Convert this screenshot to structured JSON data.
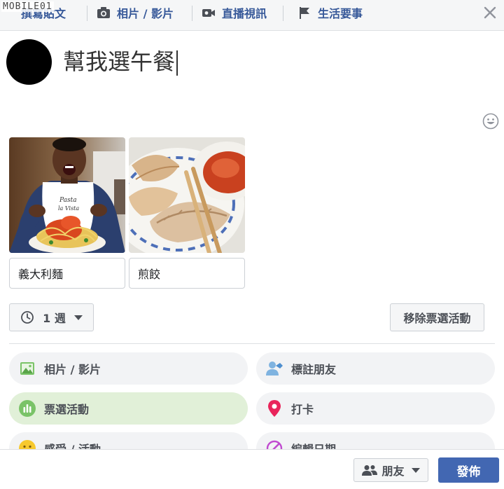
{
  "watermark": "MOBILE01",
  "tabs": [
    {
      "label": "撰寫貼文",
      "icon": "pencil-icon"
    },
    {
      "label": "相片 / 影片",
      "icon": "camera-icon"
    },
    {
      "label": "直播視訊",
      "icon": "video-camera-icon"
    },
    {
      "label": "生活要事",
      "icon": "flag-icon"
    }
  ],
  "compose": {
    "text": "幫我選午餐",
    "avatar_color": "#000000"
  },
  "poll": {
    "options": [
      {
        "value": "義大利麵",
        "image": "spaghetti-photo"
      },
      {
        "value": "煎餃",
        "image": "dumplings-photo"
      }
    ],
    "duration": "1 週",
    "remove_label": "移除票選活動"
  },
  "actions": [
    {
      "label": "相片 / 影片",
      "icon": "photo-icon",
      "active": false
    },
    {
      "label": "標註朋友",
      "icon": "tag-friends-icon",
      "active": false
    },
    {
      "label": "票選活動",
      "icon": "poll-icon",
      "active": true
    },
    {
      "label": "打卡",
      "icon": "location-pin-icon",
      "active": false
    },
    {
      "label": "感受 / 活動",
      "icon": "feeling-icon",
      "active": false
    },
    {
      "label": "編輯日期",
      "icon": "edit-date-icon",
      "active": false
    }
  ],
  "footer": {
    "audience": "朋友",
    "post_label": "發佈"
  },
  "colors": {
    "link_blue": "#365899",
    "post_button": "#4267b2",
    "active_pill": "#e1f0d8",
    "poll_green": "#7ac368",
    "pin_pink": "#e9245b"
  }
}
